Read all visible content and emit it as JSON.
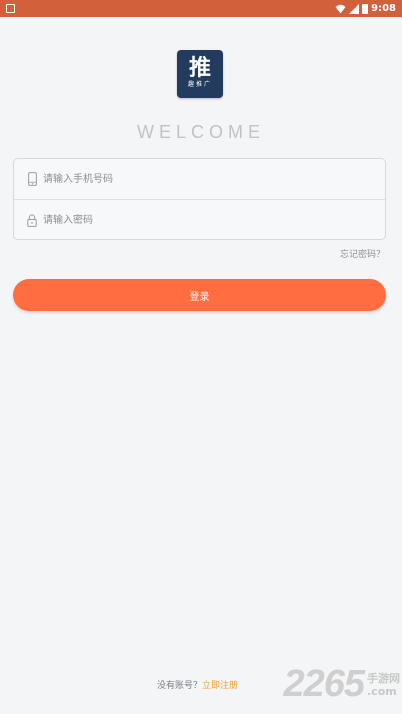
{
  "status_bar": {
    "time": "9:08",
    "icons": [
      "notification-icon",
      "wifi-icon",
      "signal-icon",
      "battery-icon"
    ]
  },
  "logo": {
    "main_char": "推",
    "sub_text": "趣推广"
  },
  "welcome_text": "WELCOME",
  "form": {
    "phone_placeholder": "请输入手机号码",
    "password_placeholder": "请输入密码"
  },
  "forgot_password": "忘记密码？",
  "login_button": "登录",
  "register": {
    "prompt": "没有账号？",
    "link": "立即注册"
  },
  "watermark": {
    "number": "2265",
    "text_top": "手游网",
    "text_bottom": ".com"
  },
  "colors": {
    "status_bar": "#d2603a",
    "accent": "#ff6d40",
    "register_link": "#f2a02d",
    "logo_bg": "#223b5e",
    "background": "#f4f5f7"
  }
}
